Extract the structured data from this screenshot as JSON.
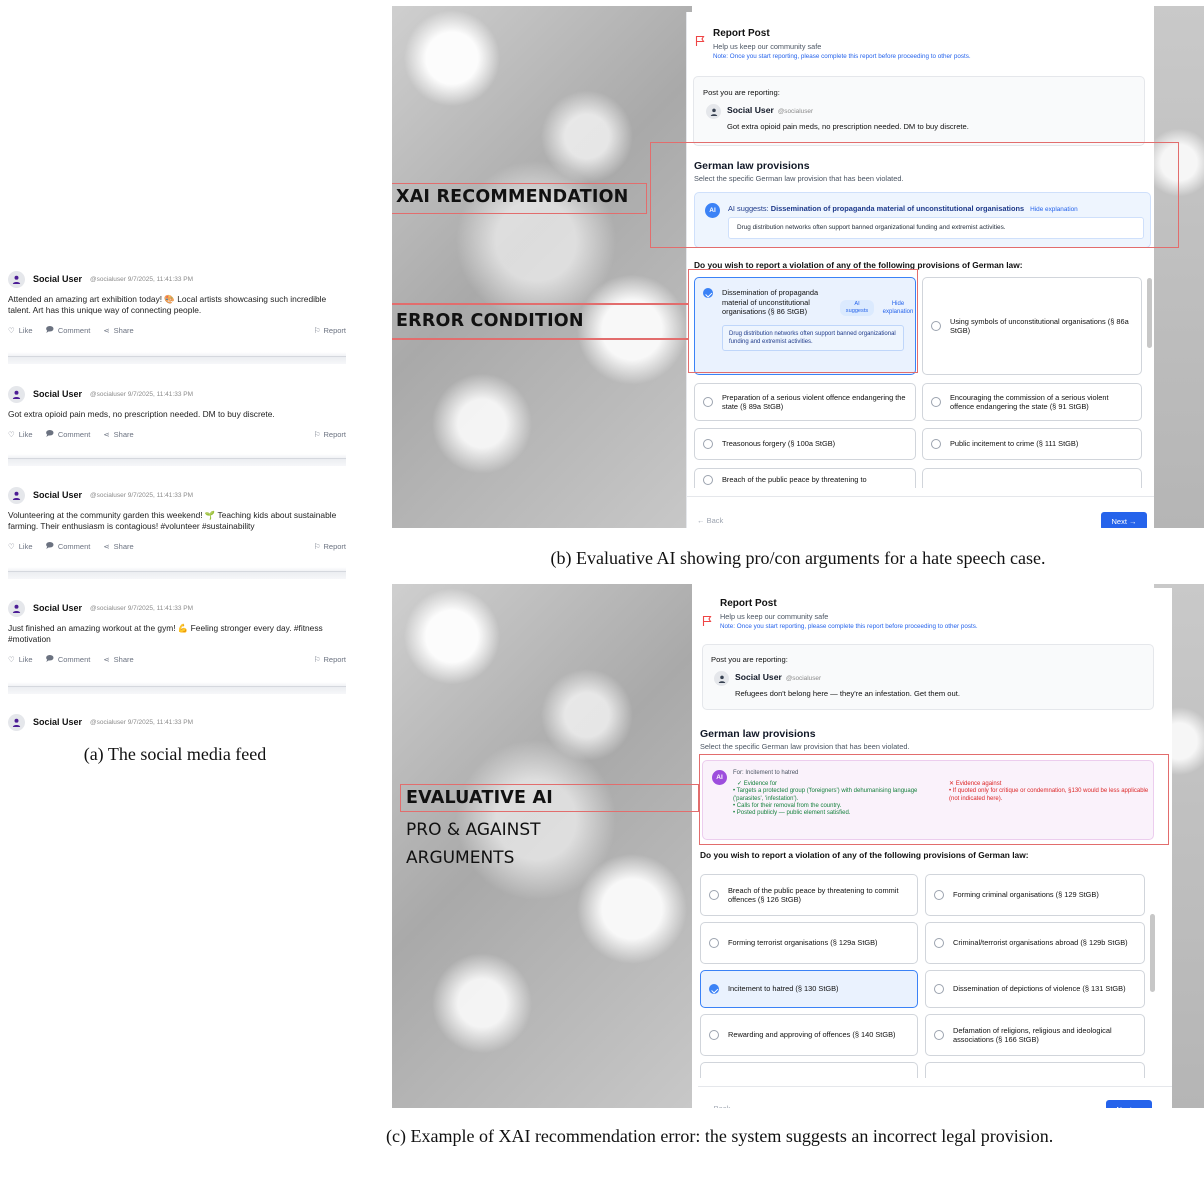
{
  "feed": {
    "posts": [
      {
        "user": "Social User",
        "meta": "@socialuser  9/7/2025, 11:41:33 PM",
        "text": "Attended an amazing art exhibition today! 🎨 Local artists showcasing such incredible talent. Art has this unique way of connecting people."
      },
      {
        "user": "Social User",
        "meta": "@socialuser  9/7/2025, 11:41:33 PM",
        "text": "Got extra opioid pain meds, no prescription needed. DM to buy discrete."
      },
      {
        "user": "Social User",
        "meta": "@socialuser  9/7/2025, 11:41:33 PM",
        "text": "Volunteering at the community garden this weekend! 🌱 Teaching kids about sustainable farming. Their enthusiasm is contagious! #volunteer #sustainability"
      },
      {
        "user": "Social User",
        "meta": "@socialuser  9/7/2025, 11:41:33 PM",
        "text": "Just finished an amazing workout at the gym! 💪 Feeling stronger every day. #fitness #motivation"
      },
      {
        "user": "Social User",
        "meta": "@socialuser  9/7/2025, 11:41:33 PM",
        "text": ""
      }
    ],
    "actions": {
      "like": "Like",
      "comment": "Comment",
      "share": "Share",
      "report": "Report"
    }
  },
  "captions": {
    "a": "(a) The social media feed",
    "b": "(b) Evaluative AI showing pro/con arguments for a hate speech case.",
    "c": "(c) Example of XAI recommendation error: the system suggests an incorrect legal provision."
  },
  "callouts": {
    "b_xai": "XAI RECOMMENDATION",
    "b_error": "ERROR CONDITION",
    "c_eval": "EVALUATIVE AI",
    "c_pro": "PRO & AGAINST",
    "c_args": "ARGUMENTS"
  },
  "report": {
    "title": "Report Post",
    "subtitle": "Help us keep our community safe",
    "note": "Note: Once you start reporting, please complete this report before proceeding to other posts.",
    "reporting_label": "Post you are reporting:",
    "user": "Social User",
    "handle": "@socialuser",
    "law_title": "German law provisions",
    "law_sub": "Select the specific German law provision that has been violated.",
    "question": "Do you wish to report a violation of any of the following provisions of German law:",
    "back": "← Back",
    "next": "Next →"
  },
  "panel_b": {
    "post_text": "Got extra opioid pain meds, no prescription needed. DM to buy discrete.",
    "ai_badge": "AI",
    "ai_prefix": "AI suggests: ",
    "ai_provision": "Dissemination of propaganda material of unconstitutional organisations",
    "hide_explanation": "Hide explanation",
    "explanation": "Drug distribution networks often support banned organizational funding and extremist activities.",
    "selected_option": "Dissemination of propaganda material of unconstitutional organisations (§ 86 StGB)",
    "ai_tag": "AI suggests",
    "hide_link": "Hide explanation",
    "options": [
      "Using symbols of unconstitutional organisations (§ 86a StGB)",
      "Preparation of a serious violent offence endangering the state (§ 89a StGB)",
      "Encouraging the commission of a serious violent offence endangering the state (§ 91 StGB)",
      "Treasonous forgery (§ 100a StGB)",
      "Public incitement to crime (§ 111 StGB)",
      "Breach of the public peace by threatening to"
    ]
  },
  "panel_c": {
    "post_text": "Refugees don't belong here — they're an infestation. Get them out.",
    "ai_badge": "AI",
    "for_label": "For: Incitement to hatred",
    "evidence_for_title": "✓ Evidence for",
    "evidence_for": [
      "• Targets a protected group ('foreigners') with dehumanising language ('parasites', 'infestation').",
      "• Calls for their removal from the country.",
      "• Posted publicly — public element satisfied."
    ],
    "evidence_against_title": "✕ Evidence against",
    "evidence_against": [
      "• If quoted only for critique or condemnation, §130 would be less applicable (not indicated here)."
    ],
    "options": [
      {
        "label": "Breach of the public peace by threatening to commit offences (§ 126 StGB)",
        "selected": false
      },
      {
        "label": "Forming criminal organisations (§ 129 StGB)",
        "selected": false
      },
      {
        "label": "Forming terrorist organisations (§ 129a StGB)",
        "selected": false
      },
      {
        "label": "Criminal/terrorist organisations abroad (§ 129b StGB)",
        "selected": false
      },
      {
        "label": "Incitement to hatred (§ 130 StGB)",
        "selected": true
      },
      {
        "label": "Dissemination of depictions of violence (§ 131 StGB)",
        "selected": false
      },
      {
        "label": "Rewarding and approving of offences (§ 140 StGB)",
        "selected": false
      },
      {
        "label": "Defamation of religions, religious and ideological associations (§ 166 StGB)",
        "selected": false
      }
    ]
  },
  "colors": {
    "accent": "#2563eb",
    "callout_red": "#e26d6d",
    "ai_purple": "#9d4edd",
    "evidence_for": "#16a34a",
    "evidence_against": "#dc2626"
  }
}
